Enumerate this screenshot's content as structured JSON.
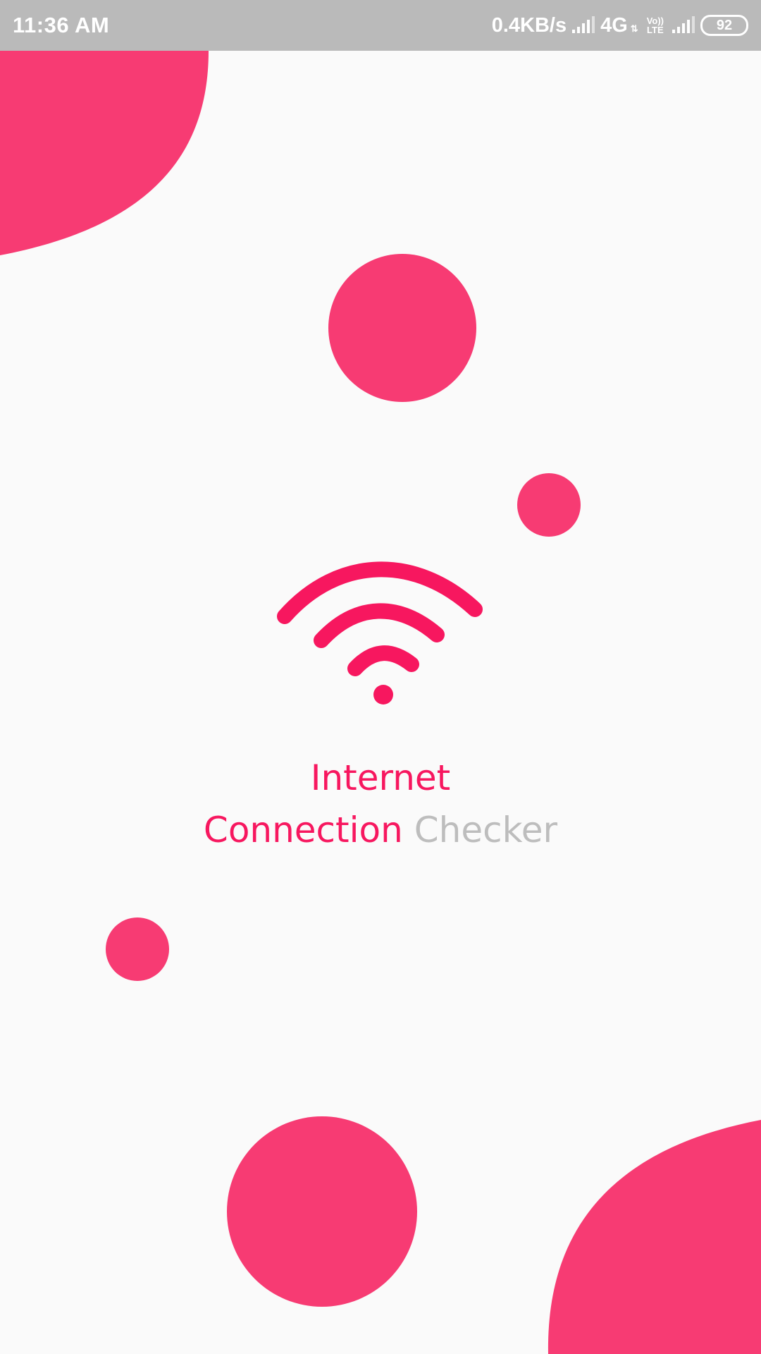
{
  "status_bar": {
    "time": "11:36 AM",
    "network_speed": "0.4KB/s",
    "network_type": "4G",
    "volte_top": "Vo))",
    "volte_bottom": "LTE",
    "battery": "92",
    "icons": [
      "signal-icon",
      "data-arrows-icon",
      "volte-icon",
      "signal-icon",
      "battery-icon"
    ]
  },
  "splash": {
    "logo_icon": "wifi-icon",
    "title_line1": "Internet",
    "title_word_connection": "Connection",
    "title_word_checker": "Checker"
  },
  "colors": {
    "accent": "#f7175f",
    "shape": "#f73b73",
    "muted_text": "#bdbdbd",
    "background": "#fafafa",
    "status_bar": "#bababa"
  }
}
